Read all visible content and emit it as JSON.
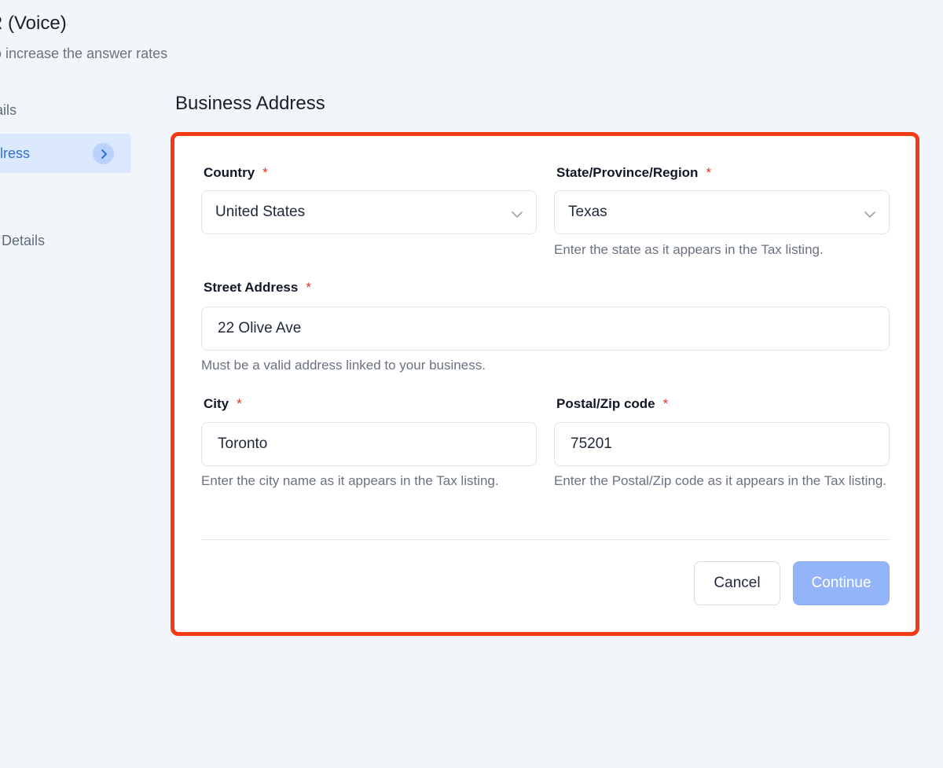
{
  "page": {
    "title": "R (Voice)",
    "subtitle": "o increase the answer rates"
  },
  "sidebar": {
    "items": [
      {
        "label": "ails"
      },
      {
        "label": "lress",
        "active": true
      },
      {
        "label": " Details"
      }
    ]
  },
  "section": {
    "title": "Business Address"
  },
  "form": {
    "required_mark": "*",
    "country": {
      "label": "Country",
      "value": "United States"
    },
    "state": {
      "label": "State/Province/Region",
      "value": "Texas",
      "hint": "Enter the state as it appears in the Tax listing."
    },
    "street": {
      "label": "Street Address",
      "value": "22 Olive Ave",
      "hint": "Must be a valid address linked to your business."
    },
    "city": {
      "label": "City",
      "value": "Toronto",
      "hint": "Enter the city name as it appears in the Tax listing."
    },
    "postal": {
      "label": "Postal/Zip code",
      "value": "75201",
      "hint": "Enter the Postal/Zip code as it appears in the Tax listing."
    }
  },
  "actions": {
    "cancel_label": "Cancel",
    "continue_label": "Continue",
    "continue_disabled": true
  },
  "colors": {
    "highlight_border": "#f23a14",
    "accent": "#2f6fe0",
    "required": "#e5301b",
    "continue_disabled_bg": "#93b4f8"
  }
}
